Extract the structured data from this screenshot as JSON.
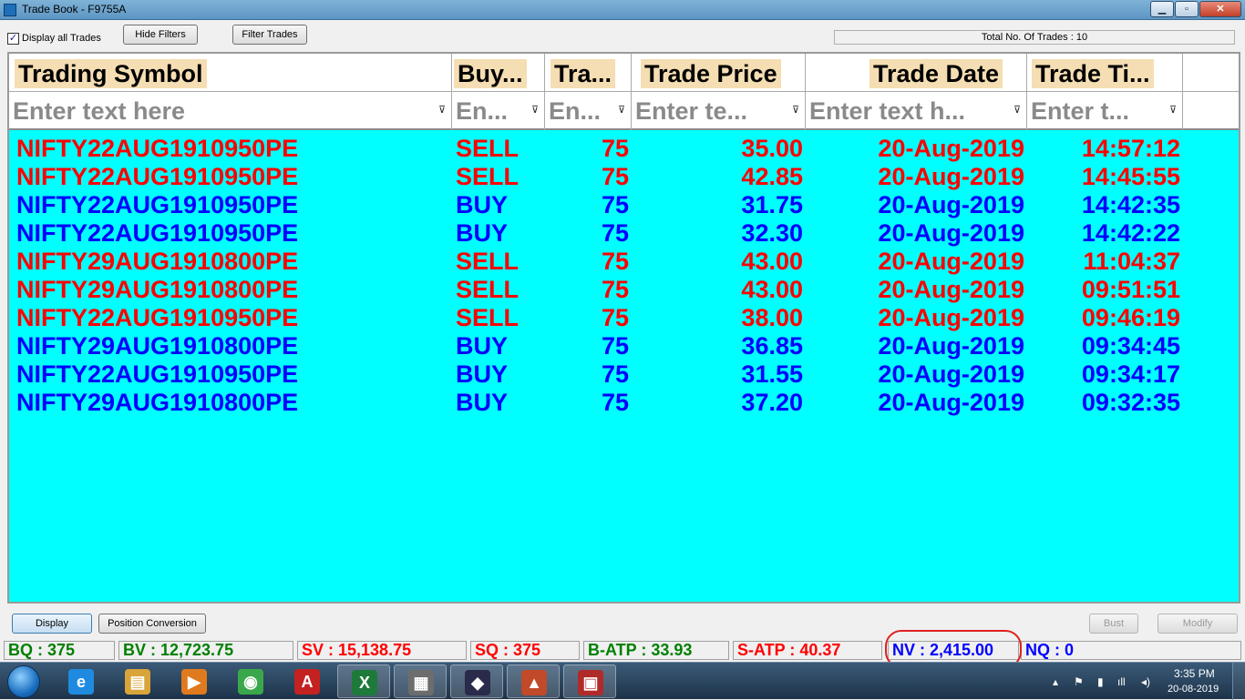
{
  "window": {
    "title": "Trade Book - F9755A",
    "min_glyph": "▁",
    "max_glyph": "▫",
    "close_glyph": "✕"
  },
  "toolbar": {
    "display_all_checked": "✓",
    "display_all_label": "Display all Trades",
    "hide_filters_label": "Hide Filters",
    "filter_trades_label": "Filter Trades",
    "total_trades": "Total No. Of Trades : 10"
  },
  "grid": {
    "columns": [
      {
        "header": "Trading Symbol",
        "filter_placeholder": "Enter text here"
      },
      {
        "header": "Buy...",
        "filter_placeholder": "En..."
      },
      {
        "header": "Tra...",
        "filter_placeholder": "En..."
      },
      {
        "header": "Trade Price",
        "filter_placeholder": "Enter te..."
      },
      {
        "header": "Trade Date",
        "filter_placeholder": "Enter text h..."
      },
      {
        "header": "Trade Ti...",
        "filter_placeholder": "Enter t..."
      }
    ],
    "filter_icon": "filter-icon",
    "filter_glyph": "⊽",
    "rows": [
      {
        "symbol": "NIFTY22AUG1910950PE",
        "side": "SELL",
        "qty": "75",
        "price": "35.00",
        "date": "20-Aug-2019",
        "time": "14:57:12"
      },
      {
        "symbol": "NIFTY22AUG1910950PE",
        "side": "SELL",
        "qty": "75",
        "price": "42.85",
        "date": "20-Aug-2019",
        "time": "14:45:55"
      },
      {
        "symbol": "NIFTY22AUG1910950PE",
        "side": "BUY",
        "qty": "75",
        "price": "31.75",
        "date": "20-Aug-2019",
        "time": "14:42:35"
      },
      {
        "symbol": "NIFTY22AUG1910950PE",
        "side": "BUY",
        "qty": "75",
        "price": "32.30",
        "date": "20-Aug-2019",
        "time": "14:42:22"
      },
      {
        "symbol": "NIFTY29AUG1910800PE",
        "side": "SELL",
        "qty": "75",
        "price": "43.00",
        "date": "20-Aug-2019",
        "time": "11:04:37"
      },
      {
        "symbol": "NIFTY29AUG1910800PE",
        "side": "SELL",
        "qty": "75",
        "price": "43.00",
        "date": "20-Aug-2019",
        "time": "09:51:51"
      },
      {
        "symbol": "NIFTY22AUG1910950PE",
        "side": "SELL",
        "qty": "75",
        "price": "38.00",
        "date": "20-Aug-2019",
        "time": "09:46:19"
      },
      {
        "symbol": "NIFTY29AUG1910800PE",
        "side": "BUY",
        "qty": "75",
        "price": "36.85",
        "date": "20-Aug-2019",
        "time": "09:34:45"
      },
      {
        "symbol": "NIFTY22AUG1910950PE",
        "side": "BUY",
        "qty": "75",
        "price": "31.55",
        "date": "20-Aug-2019",
        "time": "09:34:17"
      },
      {
        "symbol": "NIFTY29AUG1910800PE",
        "side": "BUY",
        "qty": "75",
        "price": "37.20",
        "date": "20-Aug-2019",
        "time": "09:32:35"
      }
    ],
    "colors": {
      "buy": "#0000ff",
      "sell": "#ff0000",
      "background": "#00ffff"
    }
  },
  "actions": {
    "display_label": "Display",
    "position_conversion_label": "Position Conversion",
    "bust_label": "Bust",
    "modify_label": "Modify"
  },
  "status": {
    "bq": "BQ : 375",
    "bv": "BV : 12,723.75",
    "sv": "SV : 15,138.75",
    "sq": "SQ : 375",
    "batp": "B-ATP : 33.93",
    "satp": "S-ATP : 40.37",
    "nv": "NV : 2,415.00",
    "nq": "NQ : 0"
  },
  "taskbar": {
    "apps": [
      {
        "name": "internet-explorer-icon",
        "glyph": "e"
      },
      {
        "name": "file-explorer-icon",
        "glyph": "▤"
      },
      {
        "name": "media-player-icon",
        "glyph": "▶"
      },
      {
        "name": "chrome-icon",
        "glyph": "◉"
      },
      {
        "name": "acrobat-reader-icon",
        "glyph": "A"
      },
      {
        "name": "excel-icon",
        "glyph": "X"
      },
      {
        "name": "calculator-icon",
        "glyph": "▦"
      },
      {
        "name": "trading-terminal-icon",
        "glyph": "◆"
      },
      {
        "name": "trading-app-icon",
        "glyph": "▲"
      },
      {
        "name": "document-app-icon",
        "glyph": "▣"
      }
    ],
    "tray": {
      "chevron_glyph": "▴",
      "flag_glyph": "⚑",
      "network_glyph": "▮",
      "signal_glyph": "ıll",
      "volume_glyph": "◂)"
    },
    "clock_time": "3:35 PM",
    "clock_date": "20-08-2019"
  }
}
